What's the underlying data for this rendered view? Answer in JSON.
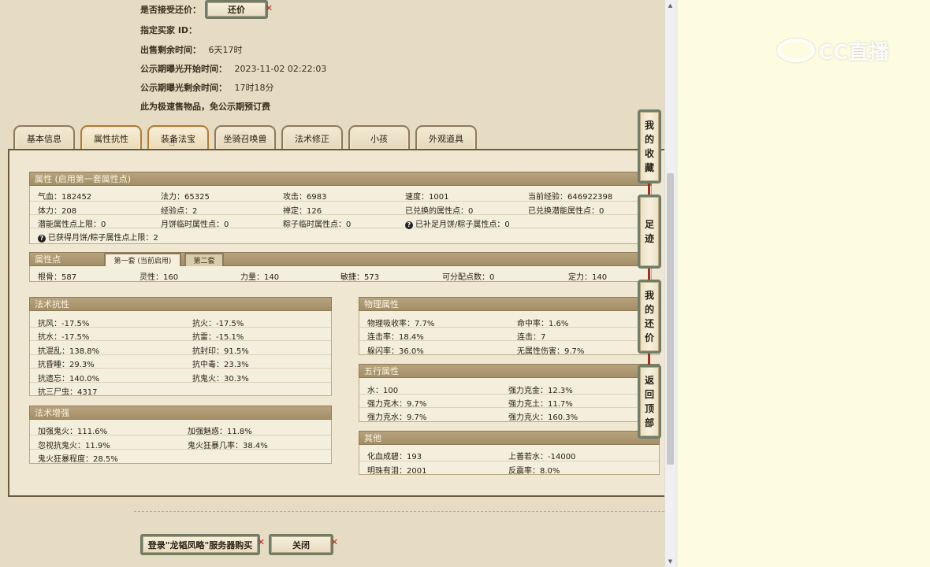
{
  "info": {
    "accept_counter_label": "是否接受还价：",
    "counter_button": "还价",
    "buyer_id_label": "指定买家 ID：",
    "buyer_id_value": "",
    "remaining_label": "出售剩余时间：",
    "remaining_value": "6天17时",
    "publicity_start_label": "公示期曝光开始时间：",
    "publicity_start_value": "2023-11-02 02:22:03",
    "publicity_remaining_label": "公示期曝光剩余时间：",
    "publicity_remaining_value": "17时18分",
    "fast_sale_note": "此为极速售物品，免公示期预订费"
  },
  "tabs": [
    "基本信息",
    "属性抗性",
    "装备法宝",
    "坐骑召唤兽",
    "法术修正",
    "小孩",
    "外观道具"
  ],
  "attributes": {
    "title": "属性 (启用第一套属性点)",
    "row1": [
      "气血：182452",
      "法力：65325",
      "攻击：6983",
      "速度：1001",
      "当前经验：646922398"
    ],
    "row2": [
      "体力：208",
      "经验点：2",
      "禅定：126",
      "已兑换的属性点：0",
      "已兑换潜能属性点：0"
    ],
    "row3": [
      "潜能属性点上限：0",
      "月饼临时属性点：0",
      "粽子临时属性点：0",
      "已补足月饼/粽子属性点：0"
    ],
    "row4": "已获得月饼/粽子属性点上限：2"
  },
  "attr_points": {
    "title": "属性点",
    "subtab1": "第一套 (当前启用)",
    "subtab2": "第二套",
    "row": [
      "根骨：587",
      "灵性：160",
      "力量：140",
      "敏捷：573",
      "可分配点数：0",
      "定力：140"
    ]
  },
  "spell_resist": {
    "title": "法术抗性",
    "cells": [
      "抗风：-17.5%",
      "抗火：-17.5%",
      "抗水：-17.5%",
      "抗雷：-15.1%",
      "抗混乱：138.8%",
      "抗封印：91.5%",
      "抗昏睡：29.3%",
      "抗中毒：23.3%",
      "抗遗忘：140.0%",
      "抗鬼火：30.3%",
      "抗三尸虫：4317"
    ]
  },
  "spell_boost": {
    "title": "法术增强",
    "cells": [
      "加强鬼火：111.6%",
      "加强魅惑：11.8%",
      "忽视抗鬼火：11.9%",
      "鬼火狂暴几率：38.4%",
      "鬼火狂暴程度：28.5%"
    ]
  },
  "physical": {
    "title": "物理属性",
    "cells": [
      "物理吸收率：7.7%",
      "命中率：1.6%",
      "连击率：18.4%",
      "连击：7",
      "躲闪率：36.0%",
      "无属性伤害：9.7%"
    ]
  },
  "five_elements": {
    "title": "五行属性",
    "cells": [
      "水：100",
      "强力克金：12.3%",
      "强力克木：9.7%",
      "强力克土：11.7%",
      "强力克水：9.7%",
      "强力克火：160.3%"
    ]
  },
  "other": {
    "title": "其他",
    "cells": [
      "化血成碧：193",
      "上善若水：-14000",
      "明珠有泪：2001",
      "反震率：8.0%"
    ]
  },
  "side_buttons": [
    [
      "我",
      "的",
      "收",
      "藏"
    ],
    [
      "足",
      "迹"
    ],
    [
      "我",
      "的",
      "还",
      "价"
    ],
    [
      "返",
      "回",
      "顶",
      "部"
    ]
  ],
  "bottom": {
    "login_buy": "登录\"龙韬凤略\"服务器购买",
    "close": "关闭"
  },
  "watermark": "CC直播",
  "colors": {
    "accent_close": "#c0221b",
    "section_header": "#a48e67",
    "frame": "#6b5a3d"
  }
}
